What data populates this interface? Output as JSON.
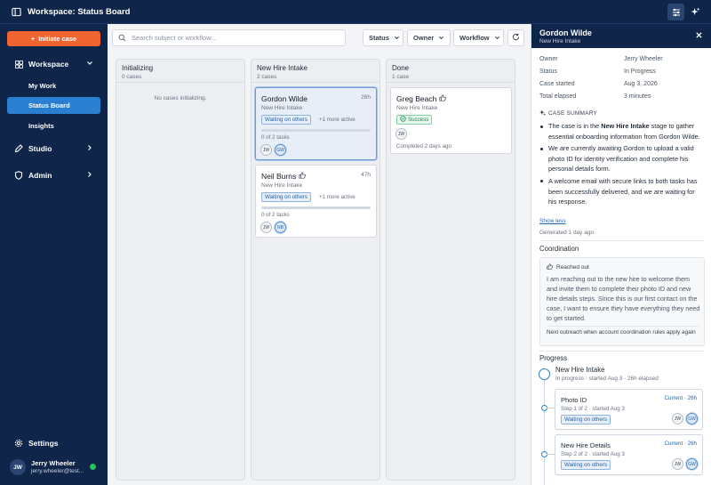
{
  "topbar": {
    "title": "Workspace: Status Board"
  },
  "sidebar": {
    "initiate_label": "Initiate case",
    "workspace": {
      "label": "Workspace",
      "items": [
        "My Work",
        "Status Board",
        "Insights"
      ]
    },
    "studio_label": "Studio",
    "admin_label": "Admin",
    "settings_label": "Settings",
    "user": {
      "initials": "JW",
      "name": "Jerry Wheeler",
      "email": "jerry.wheeler@test..."
    }
  },
  "toolbar": {
    "search_placeholder": "Search subject or workflow...",
    "filters": [
      "Status",
      "Owner",
      "Workflow"
    ]
  },
  "columns": [
    {
      "title": "Initializing",
      "count": "0 cases",
      "empty": "No cases initializing."
    },
    {
      "title": "New Hire Intake",
      "count": "2 cases",
      "cards": [
        {
          "name": "Gordon Wilde",
          "time": "26h",
          "stage": "New Hire Intake",
          "status": "Waiting on others",
          "more": "+1 more active",
          "progress": 0,
          "tasks": "0 of 2 tasks",
          "avatars": [
            "JW",
            "GW"
          ]
        },
        {
          "name": "Neil Burns",
          "time": "47h",
          "stage": "New Hire Intake",
          "status": "Waiting on others",
          "more": "+1 more active",
          "progress": 0,
          "tasks": "0 of 2 tasks",
          "avatars": [
            "JW",
            "NB"
          ]
        }
      ]
    },
    {
      "title": "Done",
      "count": "1 case",
      "cards": [
        {
          "name": "Greg Beach",
          "stage": "New Hire Intake",
          "status": "Success",
          "avatars": [
            "JW"
          ],
          "completed": "Completed 2 days ago"
        }
      ]
    }
  ],
  "detail": {
    "name": "Gordon Wilde",
    "stage": "New Hire Intake",
    "fields": [
      {
        "label": "Owner",
        "value": "Jerry Wheeler"
      },
      {
        "label": "Status",
        "value": "In Progress"
      },
      {
        "label": "Case started",
        "value": "Aug 3, 2026"
      },
      {
        "label": "Total elapsed",
        "value": "3 minutes"
      }
    ],
    "summary_title": "CASE SUMMARY",
    "summary": {
      "p1_a": "The case is in the ",
      "p1_b": "New Hire Intake",
      "p1_c": " stage to gather essential onboarding information from Gordon Wilde.",
      "p2": "We are currently awaiting Gordon to upload a valid photo ID for identity verification and complete his personal details form.",
      "p3": "A welcome email with secure links to both tasks has been successfully delivered, and we are waiting for his response."
    },
    "show_less": "Show less",
    "generated": "Generated 1 day ago",
    "coordination": {
      "title": "Coordination",
      "reached_out": "Reached out",
      "text": "I am reaching out to the new hire to welcome them and invite them to complete their photo ID and new hire details steps. Since this is our first contact on the case, I want to ensure they have everything they need to get started.",
      "next": "Next outreach when account coordination rules apply again"
    },
    "progress": {
      "title": "Progress",
      "stage_title": "New Hire Intake",
      "stage_sub": "In progress · started Aug 3 · 26h elapsed",
      "steps": [
        {
          "title": "Photo ID",
          "current": "Current · 26h",
          "sub": "Step 1 of 2 · started Aug 3",
          "status": "Waiting on others",
          "avatars": [
            "JW",
            "GW"
          ]
        },
        {
          "title": "New Hire Details",
          "current": "Current · 26h",
          "sub": "Step 2 of 2 · started Aug 3",
          "status": "Waiting on others",
          "avatars": [
            "JW",
            "GW"
          ]
        }
      ]
    }
  },
  "colors": {
    "navy": "#10254a",
    "accent_orange": "#f0652f",
    "active_blue": "#2a7fd0",
    "success_green": "#1e8a4c"
  }
}
